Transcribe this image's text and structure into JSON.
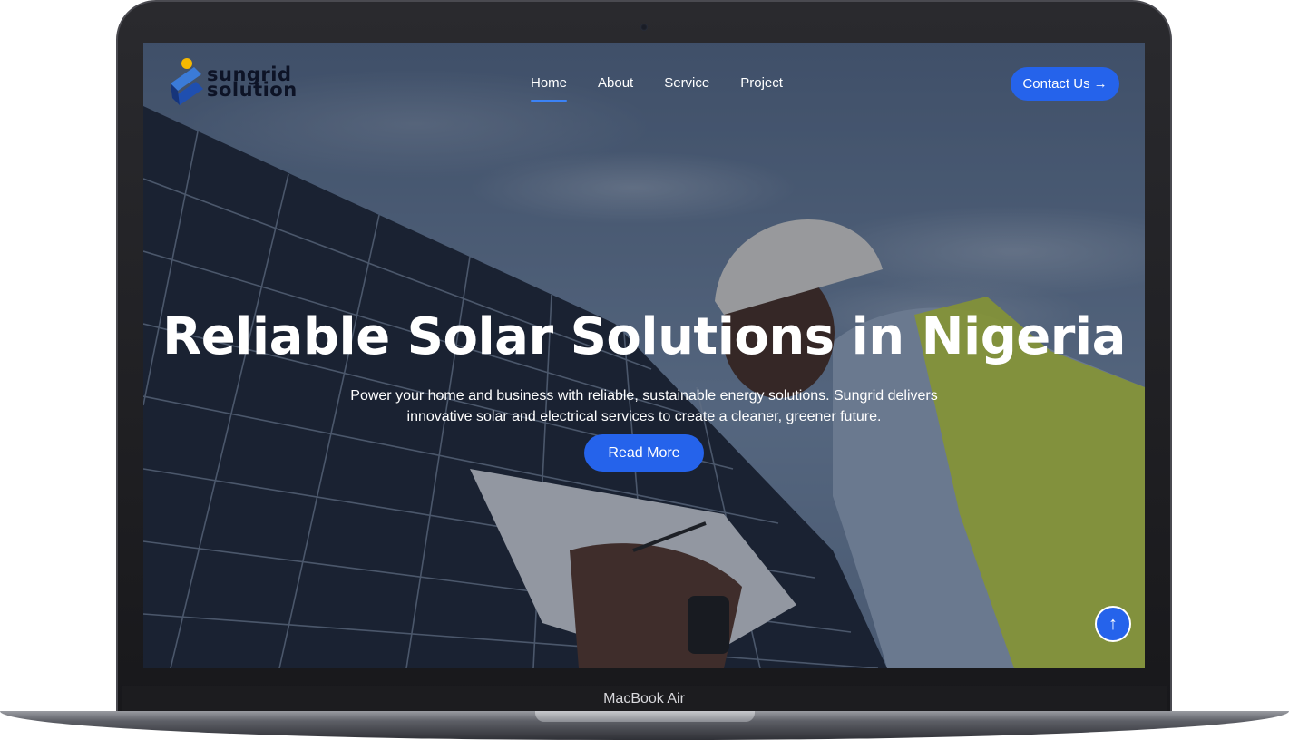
{
  "brand": {
    "line1": "sungrid",
    "line2": "solution",
    "accent": "#2563eb",
    "sun_color": "#f5b800"
  },
  "nav": {
    "items": [
      {
        "label": "Home",
        "active": true
      },
      {
        "label": "About",
        "active": false
      },
      {
        "label": "Service",
        "active": false
      },
      {
        "label": "Project",
        "active": false
      }
    ],
    "contact_label": "Contact Us",
    "contact_icon": "arrow-right-icon"
  },
  "hero": {
    "title": "Reliable Solar Solutions in Nigeria",
    "subtitle": "Power your home and business with reliable, sustainable energy solutions. Sungrid delivers innovative solar and electrical services to create a cleaner, greener future.",
    "cta_label": "Read More"
  },
  "scroll_top": {
    "icon": "arrow-up-icon",
    "glyph": "↑"
  },
  "device": {
    "label": "MacBook Air"
  }
}
